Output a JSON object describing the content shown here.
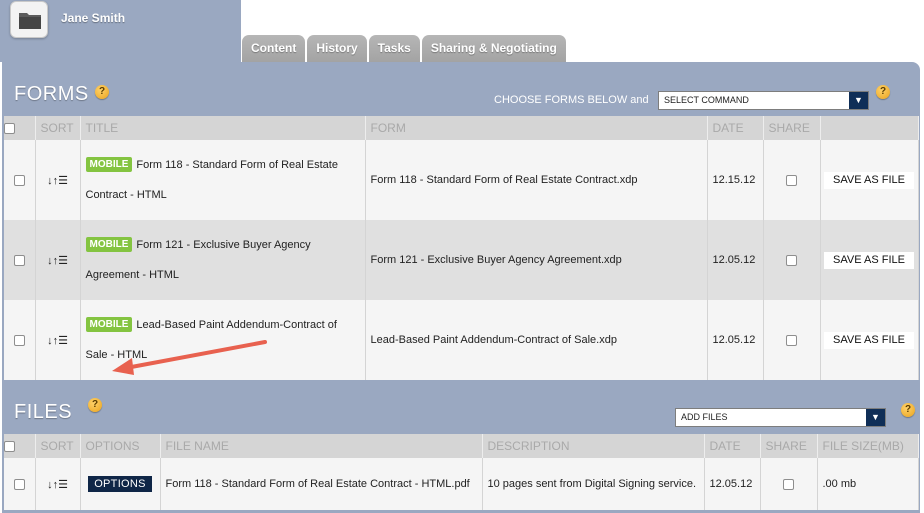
{
  "user": {
    "name": "Jane Smith",
    "avatar_icon": "folder-icon"
  },
  "tabs": [
    {
      "label": "Content"
    },
    {
      "label": "History"
    },
    {
      "label": "Tasks"
    },
    {
      "label": "Sharing & Negotiating"
    }
  ],
  "forms": {
    "title": "FORMS",
    "help": "?",
    "choose_label": "CHOOSE FORMS BELOW and",
    "command_select": {
      "value": "SELECT COMMAND",
      "arrow": "▼"
    },
    "headers": {
      "sort": "SORT",
      "title": "TITLE",
      "form": "FORM",
      "date": "DATE",
      "share": "SHARE"
    },
    "rows": [
      {
        "badge": "MOBILE",
        "title": "Form 118 - Standard Form of Real Estate Contract - HTML",
        "form": "Form 118 - Standard Form of Real Estate Contract.xdp",
        "date": "12.15.12",
        "action": "SAVE AS FILE"
      },
      {
        "badge": "MOBILE",
        "title": "Form 121 - Exclusive Buyer Agency Agreement - HTML",
        "form": "Form 121 - Exclusive Buyer Agency Agreement.xdp",
        "date": "12.05.12",
        "action": "SAVE AS FILE"
      },
      {
        "badge": "MOBILE",
        "title": "Lead-Based Paint Addendum-Contract of Sale - HTML",
        "form": "Lead-Based Paint Addendum-Contract of Sale.xdp",
        "date": "12.05.12",
        "action": "SAVE AS FILE"
      }
    ]
  },
  "files": {
    "title": "FILES",
    "help": "?",
    "add_select": {
      "value": "ADD FILES",
      "arrow": "▼"
    },
    "right_help": "?",
    "headers": {
      "sort": "SORT",
      "options": "OPTIONS",
      "file_name": "FILE NAME",
      "description": "DESCRIPTION",
      "date": "DATE",
      "share": "SHARE",
      "file_size": "FILE SIZE(MB)"
    },
    "rows": [
      {
        "options": "OPTIONS",
        "file_name": "Form 118 - Standard Form of Real Estate Contract - HTML.pdf",
        "description": "10 pages sent from Digital Signing service.",
        "date": "12.05.12",
        "size": ".00 mb"
      }
    ]
  },
  "colors": {
    "panel": "#9aa8c1",
    "accent_dark": "#0f2647",
    "badge_green": "#84c441",
    "arrow_red": "#e8614f"
  }
}
